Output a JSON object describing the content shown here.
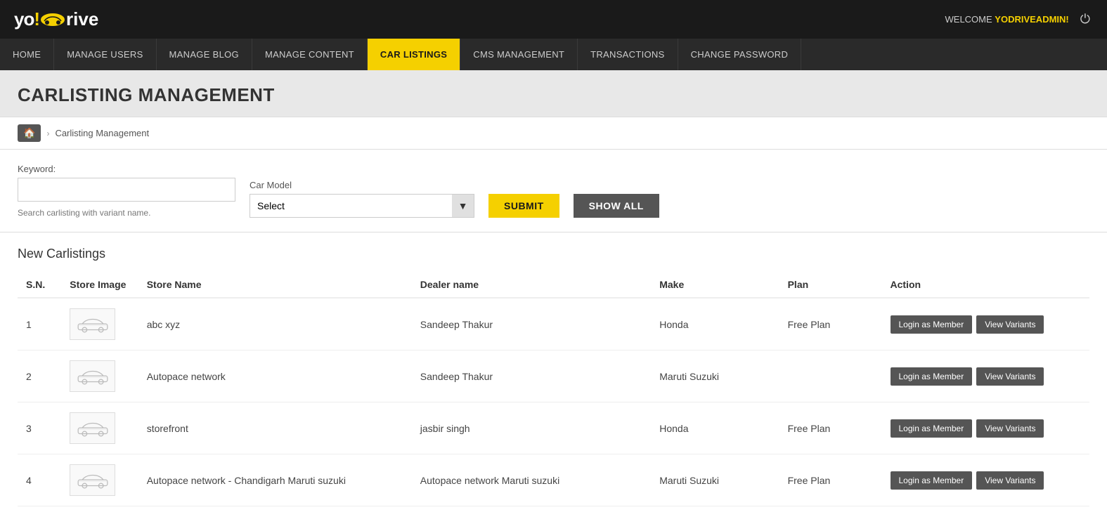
{
  "app": {
    "name_part1": "yo!",
    "name_part2": "drive",
    "welcome_prefix": "WELCOME",
    "welcome_user": "YODRIVEADMIN!",
    "power_icon": "⏻"
  },
  "nav": {
    "items": [
      {
        "id": "home",
        "label": "HOME",
        "active": false
      },
      {
        "id": "manage-users",
        "label": "MANAGE USERS",
        "active": false
      },
      {
        "id": "manage-blog",
        "label": "MANAGE BLOG",
        "active": false
      },
      {
        "id": "manage-content",
        "label": "MANAGE CONTENT",
        "active": false
      },
      {
        "id": "car-listings",
        "label": "CAR LISTINGS",
        "active": true
      },
      {
        "id": "cms-management",
        "label": "CMS MANAGEMENT",
        "active": false
      },
      {
        "id": "transactions",
        "label": "TRANSACTIONS",
        "active": false
      },
      {
        "id": "change-password",
        "label": "CHANGE PASSWORD",
        "active": false
      }
    ]
  },
  "page": {
    "title": "CARLISTING MANAGEMENT",
    "breadcrumb_home": "🏠",
    "breadcrumb_current": "Carlisting Management"
  },
  "search": {
    "keyword_label": "Keyword:",
    "keyword_placeholder": "",
    "keyword_hint": "Search carlisting with variant name.",
    "car_model_label": "Car Model",
    "car_model_placeholder": "Select",
    "submit_label": "SUBMIT",
    "show_all_label": "SHOW ALL"
  },
  "table": {
    "section_title_new": "New",
    "section_title_main": " Carlistings",
    "columns": {
      "sn": "S.N.",
      "store_image": "Store Image",
      "store_name": "Store Name",
      "dealer_name": "Dealer name",
      "make": "Make",
      "plan": "Plan",
      "action": "Action"
    },
    "rows": [
      {
        "sn": "1",
        "store_name": "abc xyz",
        "dealer_name": "Sandeep Thakur",
        "make": "Honda",
        "plan": "Free Plan",
        "btn_login": "Login as Member",
        "btn_variants": "View Variants"
      },
      {
        "sn": "2",
        "store_name": "Autopace network",
        "dealer_name": "Sandeep Thakur",
        "make": "Maruti Suzuki",
        "plan": "",
        "btn_login": "Login as Member",
        "btn_variants": "View Variants"
      },
      {
        "sn": "3",
        "store_name": "storefront",
        "dealer_name": "jasbir singh",
        "make": "Honda",
        "plan": "Free Plan",
        "btn_login": "Login as Member",
        "btn_variants": "View Variants"
      },
      {
        "sn": "4",
        "store_name": "Autopace network - Chandigarh Maruti suzuki",
        "dealer_name": "Autopace network Maruti suzuki",
        "make": "Maruti Suzuki",
        "plan": "Free Plan",
        "btn_login": "Login as Member",
        "btn_variants": "View Variants"
      }
    ]
  }
}
